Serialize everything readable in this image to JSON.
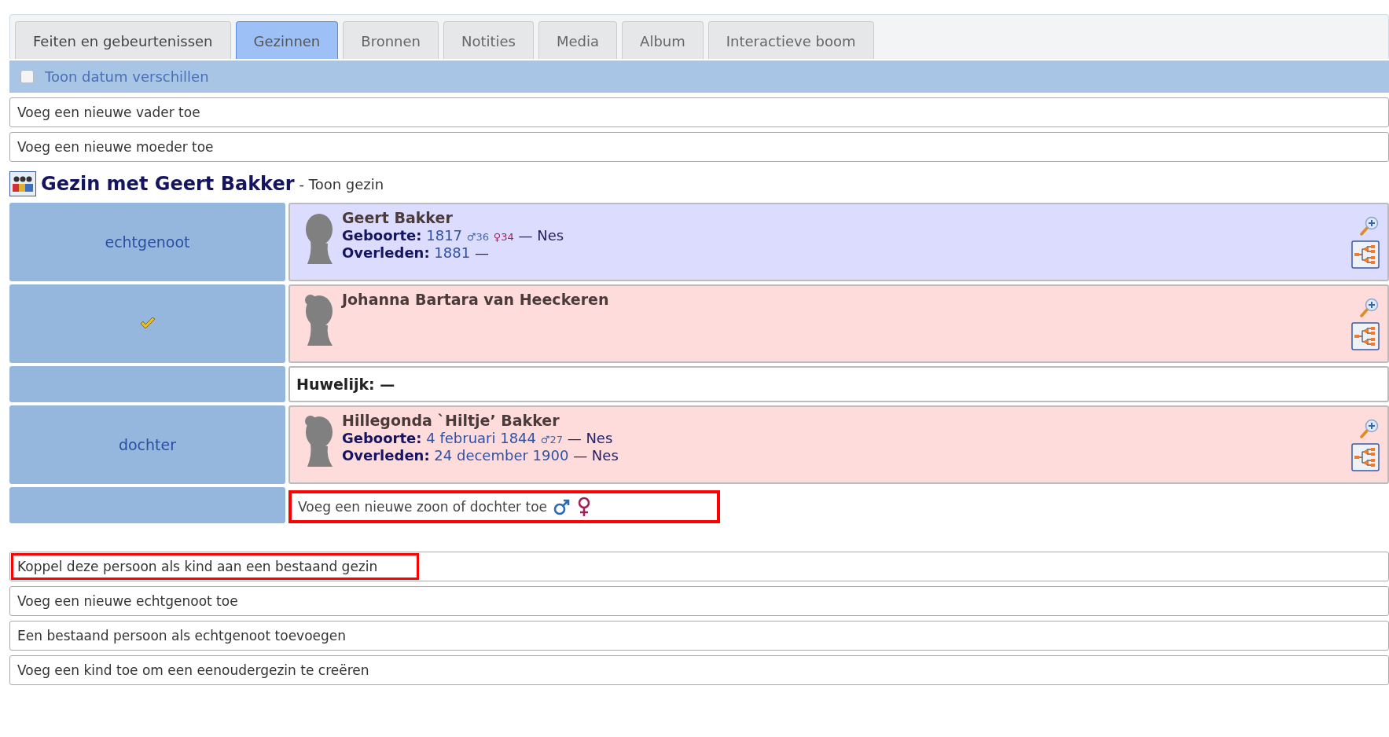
{
  "tabs": [
    {
      "label": "Feiten en gebeurtenissen",
      "selected": false
    },
    {
      "label": "Gezinnen",
      "selected": true
    },
    {
      "label": "Bronnen",
      "selected": false
    },
    {
      "label": "Notities",
      "selected": false
    },
    {
      "label": "Media",
      "selected": false
    },
    {
      "label": "Album",
      "selected": false
    },
    {
      "label": "Interactieve boom",
      "selected": false
    }
  ],
  "date_toggle": {
    "label": "Toon datum verschillen",
    "checked": false
  },
  "parent_actions": [
    {
      "label": "Voeg een nieuwe vader toe",
      "highlighted": false
    },
    {
      "label": "Voeg een nieuwe moeder toe",
      "highlighted": false
    }
  ],
  "family": {
    "title": "Gezin met Geert Bakker",
    "link": "- Toon gezin",
    "rows": [
      {
        "kind": "person",
        "role": "echtgenoot",
        "female": false,
        "name": "Geert Bakker",
        "facts": [
          {
            "label": "Geboorte:",
            "date": "1817",
            "ages": [
              {
                "kind": "father",
                "text": "♂36"
              },
              {
                "kind": "mother",
                "text": "♀34"
              }
            ],
            "place": "— Nes"
          },
          {
            "label": "Overleden:",
            "date": "1881",
            "place": "—"
          }
        ]
      },
      {
        "kind": "person",
        "role_check": true,
        "female": true,
        "name": "Johanna Bartara van Heeckeren",
        "facts": []
      },
      {
        "kind": "marriage",
        "label": "Huwelijk:",
        "value": "—"
      },
      {
        "kind": "person",
        "role": "dochter",
        "female": true,
        "name": "Hillegonda `Hiltje’ Bakker",
        "facts": [
          {
            "label": "Geboorte:",
            "date": "4 februari 1844",
            "ages": [
              {
                "kind": "father",
                "text": "♂27"
              }
            ],
            "place": "— Nes"
          },
          {
            "label": "Overleden:",
            "date": "24 december 1900",
            "place": "— Nes"
          }
        ]
      },
      {
        "kind": "add_child",
        "label": "Voeg een nieuwe zoon of dochter toe",
        "highlighted": true
      }
    ]
  },
  "actions": [
    {
      "label": "Koppel deze persoon als kind aan een bestaand gezin",
      "highlighted": true
    },
    {
      "label": "Voeg een nieuwe echtgenoot toe",
      "highlighted": false
    },
    {
      "label": "Een bestaand persoon als echtgenoot toevoegen",
      "highlighted": false
    },
    {
      "label": "Voeg een kind toe om een eenoudergezin te creëren",
      "highlighted": false
    }
  ]
}
